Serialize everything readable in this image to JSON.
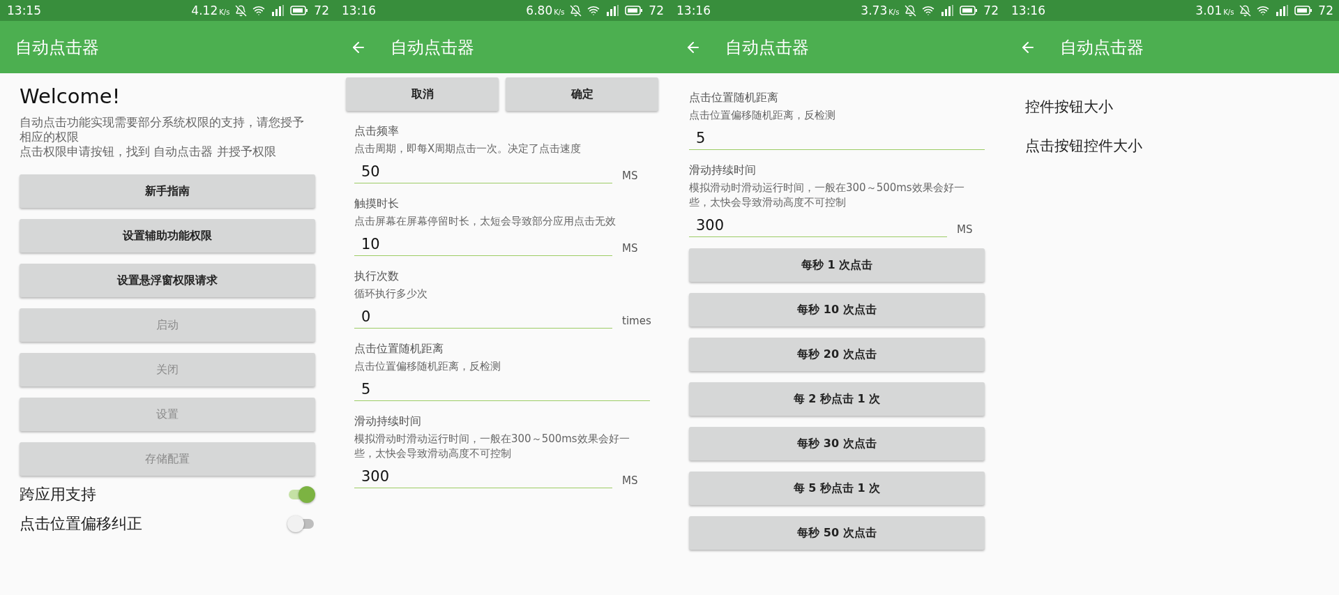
{
  "screens": [
    {
      "status_bar": {
        "time": "13:15",
        "speed": "4.12",
        "speed_unit": "K/s",
        "battery": "72"
      },
      "app_bar": {
        "title": "自动点击器",
        "back": false
      },
      "blocks": [
        {
          "kind": "heading",
          "text": "Welcome!"
        },
        {
          "kind": "paragraph",
          "text": "自动点击功能实现需要部分系统权限的支持，请您授予相应的权限"
        },
        {
          "kind": "paragraph",
          "text": "点击权限申请按钮，找到 自动点击器 并授予权限"
        },
        {
          "kind": "button",
          "label": "新手指南",
          "disabled": false
        },
        {
          "kind": "button",
          "label": "设置辅助功能权限",
          "disabled": false
        },
        {
          "kind": "button",
          "label": "设置悬浮窗权限请求",
          "disabled": false
        },
        {
          "kind": "button",
          "label": "启动",
          "disabled": true
        },
        {
          "kind": "button",
          "label": "关闭",
          "disabled": true
        },
        {
          "kind": "button",
          "label": "设置",
          "disabled": true
        },
        {
          "kind": "button",
          "label": "存储配置",
          "disabled": true
        },
        {
          "kind": "toggle",
          "label": "跨应用支持",
          "on": true
        },
        {
          "kind": "toggle",
          "label": "点击位置偏移纠正",
          "on": false
        }
      ]
    },
    {
      "status_bar": {
        "time": "13:16",
        "speed": "6.80",
        "speed_unit": "K/s",
        "battery": "72"
      },
      "app_bar": {
        "title": "自动点击器",
        "back": true
      },
      "blocks": [
        {
          "kind": "button_pair",
          "labels": [
            "取消",
            "确定"
          ]
        },
        {
          "kind": "setting",
          "title": "点击频率",
          "description": "点击周期，即每X周期点击一次。决定了点击速度",
          "value": "50",
          "unit": "MS"
        },
        {
          "kind": "setting",
          "title": "触摸时长",
          "description": "点击屏幕在屏幕停留时长，太短会导致部分应用点击无效",
          "value": "10",
          "unit": "MS"
        },
        {
          "kind": "setting",
          "title": "执行次数",
          "description": "循环执行多少次",
          "value": "0",
          "unit": "times"
        },
        {
          "kind": "setting",
          "title": "点击位置随机距离",
          "description": "点击位置偏移随机距离，反检测",
          "value": "5"
        },
        {
          "kind": "setting",
          "title": "滑动持续时间",
          "description": "模拟滑动时滑动运行时间，一般在300～500ms效果会好一些，太快会导致滑动高度不可控制",
          "value": "300",
          "unit": "MS"
        }
      ]
    },
    {
      "status_bar": {
        "time": "13:16",
        "speed": "3.73",
        "speed_unit": "K/s",
        "battery": "72"
      },
      "app_bar": {
        "title": "自动点击器",
        "back": true
      },
      "blocks": [
        {
          "kind": "setting",
          "title": "点击位置随机距离",
          "description": "点击位置偏移随机距离，反检测",
          "value": "5"
        },
        {
          "kind": "setting",
          "title": "滑动持续时间",
          "description": "模拟滑动时滑动运行时间，一般在300～500ms效果会好一些，太快会导致滑动高度不可控制",
          "value": "300",
          "unit": "MS"
        },
        {
          "kind": "button",
          "label": "每秒 1 次点击",
          "disabled": false
        },
        {
          "kind": "button",
          "label": "每秒 10 次点击",
          "disabled": false
        },
        {
          "kind": "button",
          "label": "每秒 20 次点击",
          "disabled": false
        },
        {
          "kind": "button",
          "label": "每 2 秒点击 1 次",
          "disabled": false
        },
        {
          "kind": "button",
          "label": "每秒 30 次点击",
          "disabled": false
        },
        {
          "kind": "button",
          "label": "每 5 秒点击 1 次",
          "disabled": false
        },
        {
          "kind": "button",
          "label": "每秒 50 次点击",
          "disabled": false
        }
      ]
    },
    {
      "status_bar": {
        "time": "13:16",
        "speed": "3.01",
        "speed_unit": "K/s",
        "battery": "72"
      },
      "app_bar": {
        "title": "自动点击器",
        "back": true
      },
      "blocks": [
        {
          "kind": "list_item",
          "text": "控件按钮大小"
        },
        {
          "kind": "list_item",
          "text": "点击按钮控件大小"
        }
      ]
    }
  ]
}
